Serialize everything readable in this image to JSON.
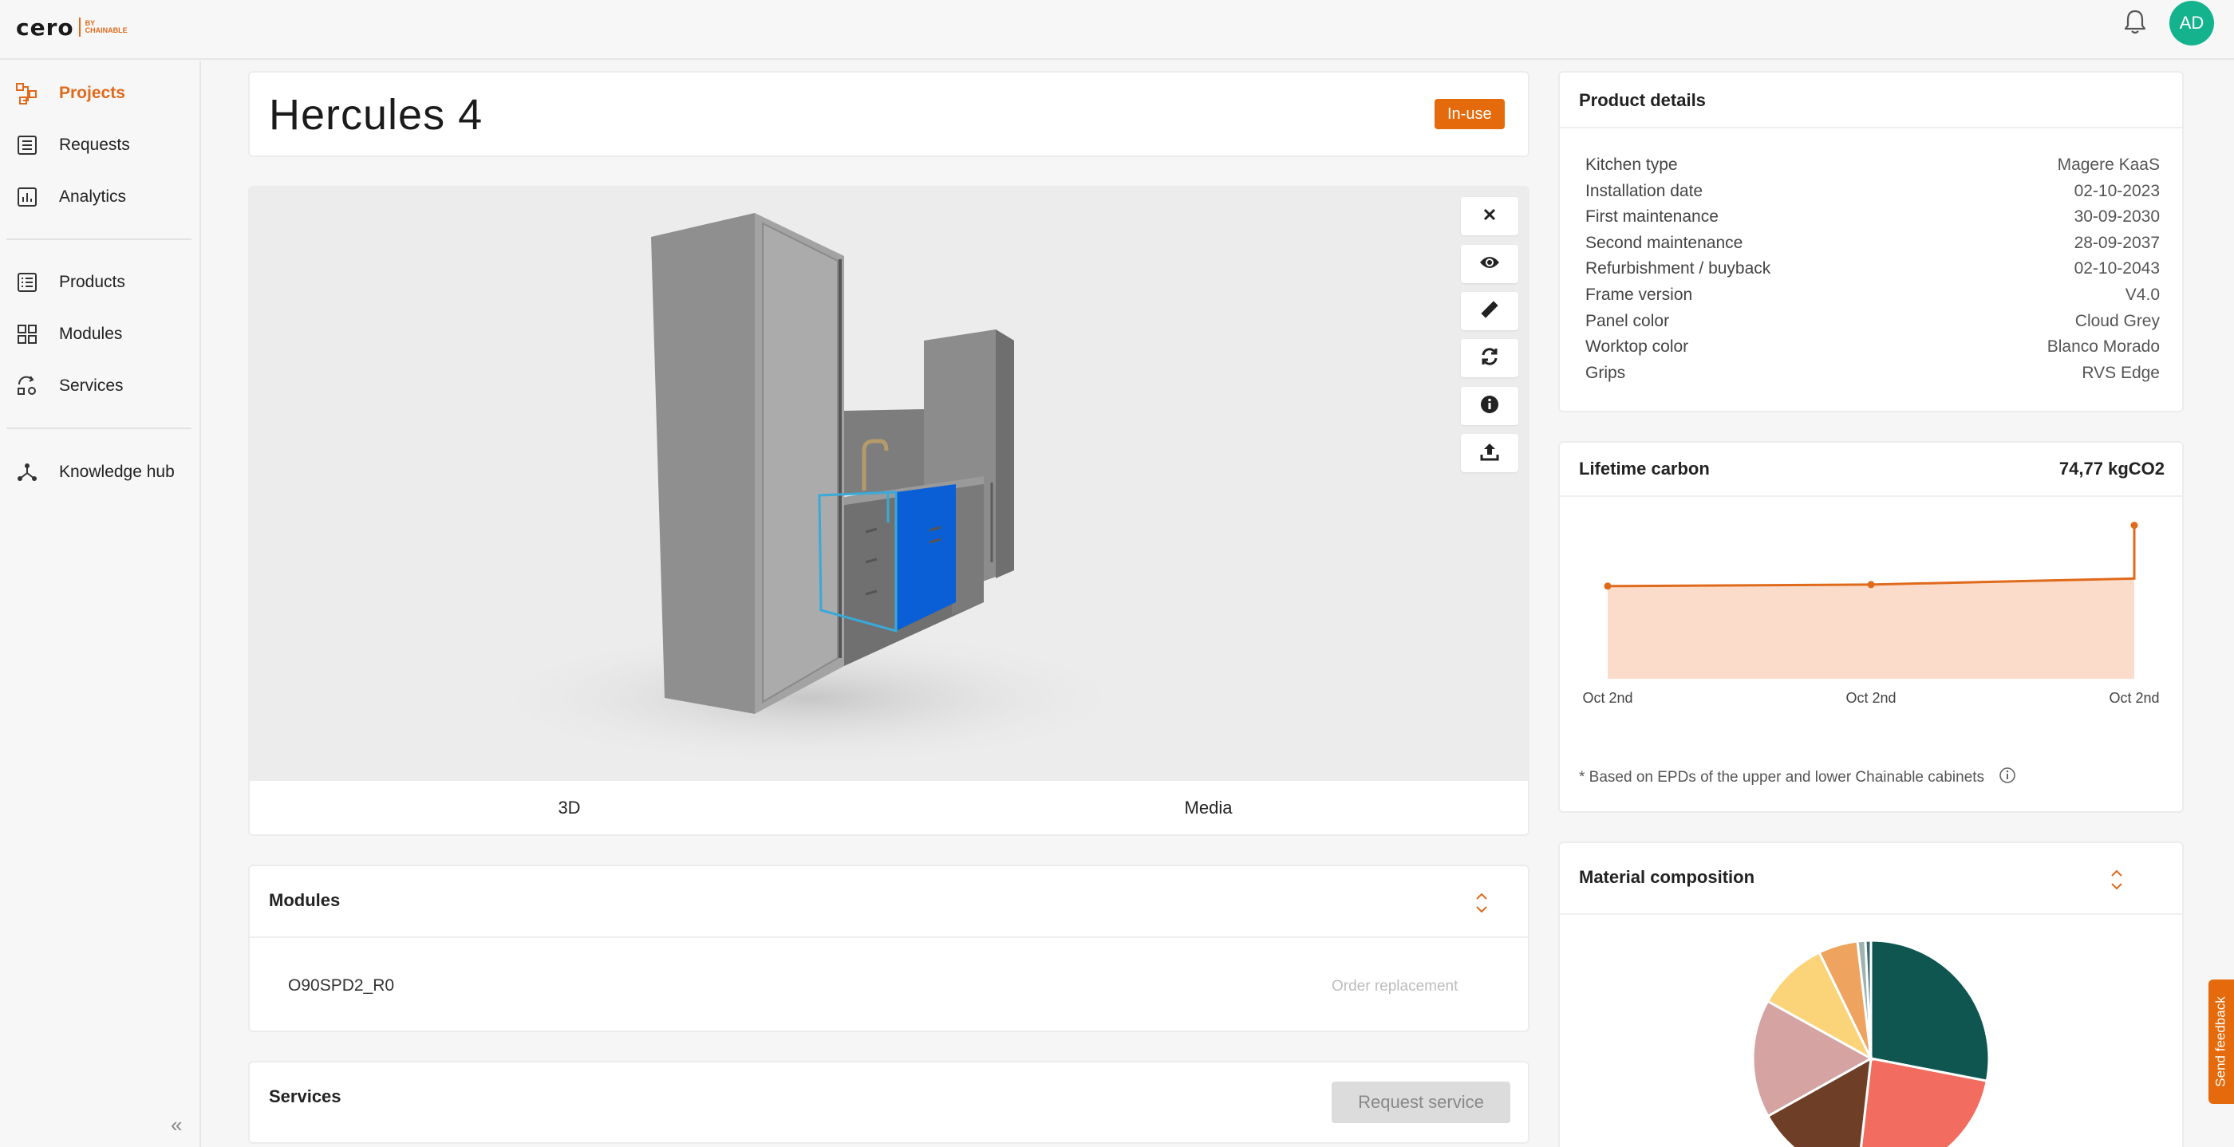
{
  "brand": {
    "word": "cero",
    "sub_top": "BY",
    "sub_bottom": "CHAINABLE"
  },
  "user": {
    "initials": "AD"
  },
  "sidebar": {
    "items": [
      {
        "label": "Projects",
        "icon": "projects-icon"
      },
      {
        "label": "Requests",
        "icon": "requests-icon"
      },
      {
        "label": "Analytics",
        "icon": "analytics-icon"
      },
      {
        "label": "Products",
        "icon": "products-icon"
      },
      {
        "label": "Modules",
        "icon": "modules-icon"
      },
      {
        "label": "Services",
        "icon": "services-icon"
      },
      {
        "label": "Knowledge hub",
        "icon": "knowledge-hub-icon"
      }
    ],
    "collapse_label": "«"
  },
  "project": {
    "title": "Hercules 4",
    "status": "In-use"
  },
  "viewer": {
    "tools": [
      "close-icon",
      "eye-icon",
      "ruler-icon",
      "refresh-icon",
      "info-icon",
      "upload-icon"
    ],
    "tabs": [
      "3D",
      "Media"
    ]
  },
  "modules": {
    "title": "Modules",
    "items": [
      {
        "code": "O90SPD2_R0",
        "action": "Order replacement"
      }
    ]
  },
  "services": {
    "title": "Services",
    "button": "Request service"
  },
  "details": {
    "title": "Product details",
    "rows": [
      {
        "label": "Kitchen type",
        "value": "Magere KaaS"
      },
      {
        "label": "Installation date",
        "value": "02-10-2023"
      },
      {
        "label": "First maintenance",
        "value": "30-09-2030"
      },
      {
        "label": "Second maintenance",
        "value": "28-09-2037"
      },
      {
        "label": "Refurbishment / buyback",
        "value": "02-10-2043"
      },
      {
        "label": "Frame version",
        "value": "V4.0"
      },
      {
        "label": "Panel color",
        "value": "Cloud Grey"
      },
      {
        "label": "Worktop color",
        "value": "Blanco Morado"
      },
      {
        "label": "Grips",
        "value": "RVS Edge"
      }
    ]
  },
  "carbon": {
    "title": "Lifetime carbon",
    "total": "74,77 kgCO2",
    "note": "* Based on EPDs of the upper and lower Chainable cabinets",
    "chart_data": {
      "type": "area",
      "x": [
        "Oct 2nd",
        "Oct 2nd",
        "Oct 2nd"
      ],
      "values": [
        61,
        62,
        66,
        101
      ],
      "ylim": [
        0,
        105
      ],
      "grid": false,
      "legend": "none",
      "color": "#e06a1c",
      "fill": "#fbdccb"
    }
  },
  "material": {
    "title": "Material composition",
    "chart_data": {
      "type": "pie",
      "values": [
        26,
        22,
        14,
        15,
        9,
        5,
        1,
        0.7
      ],
      "colors": [
        "#0f5650",
        "#f26d5f",
        "#6e3e26",
        "#d5a3a2",
        "#fbd47a",
        "#eea35f",
        "#9fb3b2",
        "#3d6c6d"
      ]
    }
  },
  "feedback": {
    "label": "Send feedback"
  },
  "colors": {
    "accent": "#e06a1c",
    "badge": "#e56a0c",
    "avatar": "#14b38e",
    "module_highlight": "#0a5fd6"
  }
}
